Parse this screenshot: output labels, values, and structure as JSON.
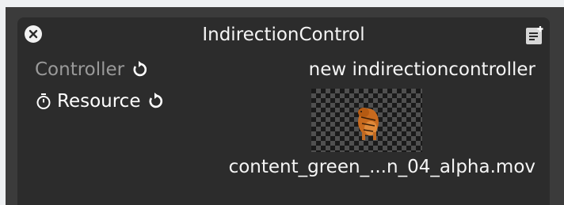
{
  "window": {
    "title": "IndirectionControl",
    "icons": {
      "close": "close-icon",
      "notes": "note-icon"
    }
  },
  "properties": {
    "controller": {
      "label": "Controller",
      "value": "new indirectioncontroller",
      "reset_icon": "reset-icon"
    },
    "resource": {
      "label": "Resource",
      "value": "content_green_...n_04_alpha.mov",
      "prefix_icon": "timer-icon",
      "reset_icon": "reset-icon",
      "thumbnail": "video-thumbnail"
    }
  },
  "colors": {
    "panel": "#2c2c2c",
    "outer": "#3b3b3b",
    "text": "#f5f5f5",
    "dim_text": "#9a9a9a"
  }
}
